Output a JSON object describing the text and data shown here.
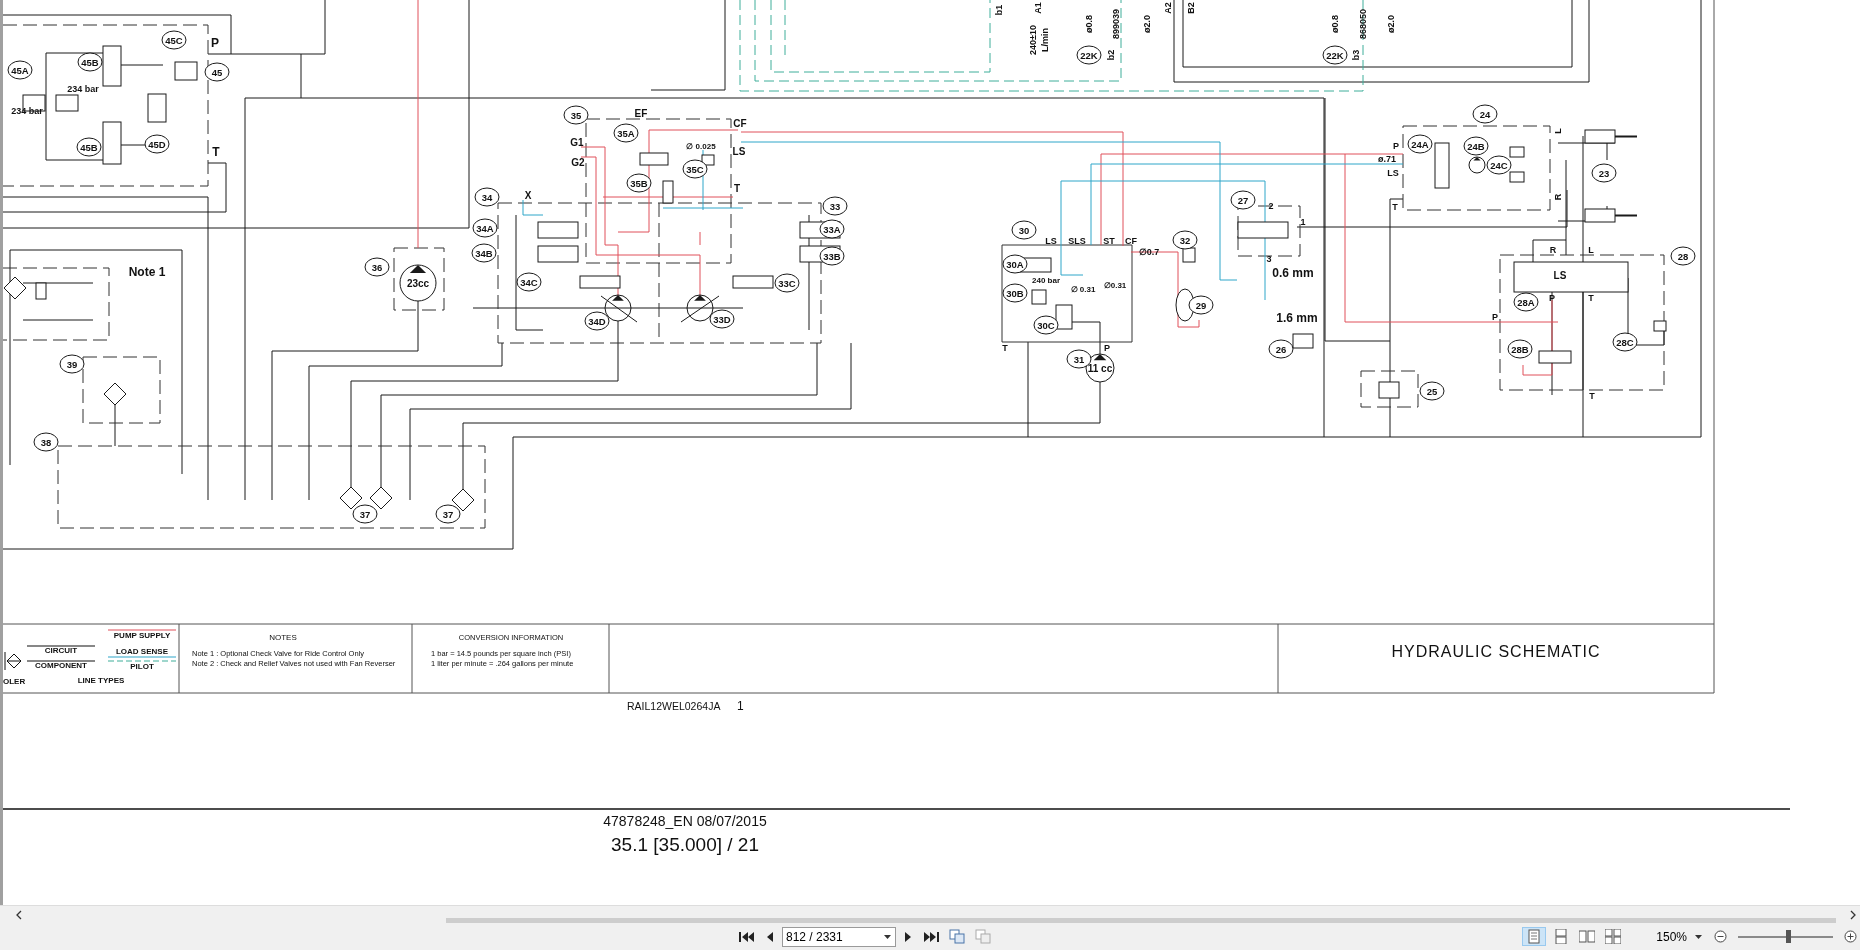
{
  "schematic": {
    "callouts": [
      "45A",
      "45C",
      "45B",
      "45",
      "45D",
      "45B",
      "35",
      "34",
      "34A",
      "34B",
      "34C",
      "36",
      "34D",
      "39",
      "38",
      "37",
      "37",
      "35A",
      "35B",
      "35C",
      "33",
      "33A",
      "33B",
      "33C",
      "33D",
      "22K",
      "30",
      "30A",
      "30B",
      "30C",
      "32",
      "29",
      "31",
      "27",
      "22K",
      "24",
      "24A",
      "24B",
      "24C",
      "23",
      "28",
      "28A",
      "28B",
      "28C",
      "26",
      "25"
    ],
    "labels": [
      "P",
      "T",
      "234 bar",
      "234 bar",
      "Note 1",
      "G1",
      "G2",
      "X",
      "23cc",
      "EF",
      "CF",
      "∅ 0.025",
      "LS",
      "T",
      "LS",
      "SLS",
      "ST",
      "CF",
      "∅0.7",
      "240 bar",
      "∅ 0.31",
      "∅0.31",
      "T",
      "P",
      "11 cc",
      "2",
      "1",
      "3",
      "0.6 mm",
      "P",
      "ø.71",
      "LS",
      "T",
      "R",
      "L",
      "LS",
      "P",
      "T",
      "P",
      "1.6 mm",
      "T"
    ],
    "vertical_labels": [
      "b1",
      "A1",
      "240±10",
      "L/min",
      "ø0.8",
      "899039",
      "ø2.0",
      "b2",
      "A2",
      "B2",
      "ø0.8",
      "868050",
      "ø2.0",
      "b3",
      "L",
      "R"
    ]
  },
  "title_block": {
    "line_types": [
      {
        "kind": "pump-supply",
        "label": "PUMP SUPPLY"
      },
      {
        "kind": "circuit",
        "label": "CIRCUIT"
      },
      {
        "kind": "load-sense",
        "label": "LOAD SENSE"
      },
      {
        "kind": "component",
        "label": "COMPONENT"
      },
      {
        "kind": "pilot",
        "label": "PILOT"
      }
    ],
    "line_types_heading": "LINE TYPES",
    "cooler_label": "OLER",
    "notes_heading": "NOTES",
    "notes": [
      "Note 1 : Optional Check Valve for Ride Control Only",
      "Note 2 : Check and Relief Valves not used with Fan Reverser"
    ],
    "conversion_heading": "CONVERSION INFORMATION",
    "conversions": [
      "1 bar = 14.5 pounds per square inch (PSI)",
      "1 liter per minute = .264 gallons per minute"
    ],
    "title": "HYDRAULIC SCHEMATIC"
  },
  "drawing_number": "RAIL12WEL0264JA",
  "sheet": "1",
  "footer": {
    "document": "47878248_EN 08/07/2015",
    "page_ref": "35.1 [35.000] / 21"
  },
  "toolbar": {
    "page_field": {
      "value": "812 / 2331"
    },
    "view_modes": [
      {
        "selected": true
      },
      {
        "selected": false
      },
      {
        "selected": false
      },
      {
        "selected": false
      }
    ],
    "zoom": {
      "value": "150%"
    },
    "zoom_slider": {
      "level": 0.53
    }
  }
}
